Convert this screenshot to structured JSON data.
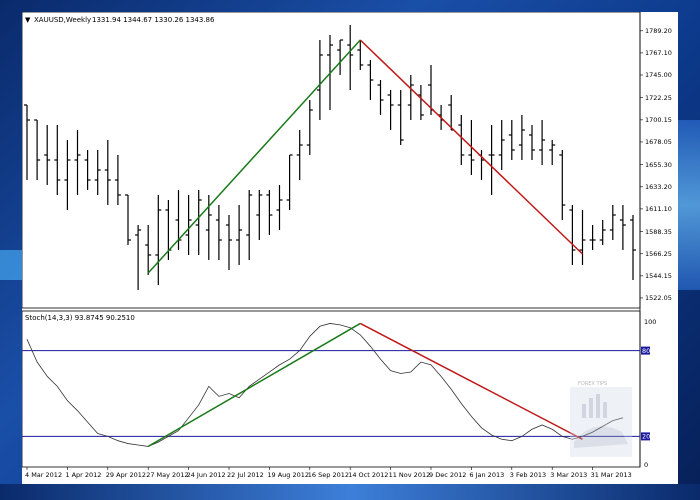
{
  "window": {
    "symbol_header": "XAUUSD,Weekly",
    "ohlc_header": "1331.94 1344.67 1330.26 1343.86",
    "indicator_header": "Stoch(14,3,3) 93.8745 90.2510",
    "watermark": "FOREX TIPS"
  },
  "colors": {
    "bars": "#000000",
    "uptrend_line": "#1a7a1a",
    "downtrend_line": "#c01818",
    "level_lines": "#1a1aa0",
    "stoch_line": "#333333"
  },
  "chart_data": {
    "type": "ohlc",
    "price_axis_ticks": [
      "1789.20",
      "1767.10",
      "1745.00",
      "1722.25",
      "1700.15",
      "1678.05",
      "1655.30",
      "1633.20",
      "1611.10",
      "1588.35",
      "1566.25",
      "1544.15",
      "1522.05"
    ],
    "stoch_axis_ticks": [
      "100",
      "80",
      "20",
      "0"
    ],
    "stoch_levels": [
      80,
      20
    ],
    "x_axis_labels": [
      "4 Mar 2012",
      "1 Apr 2012",
      "29 Apr 2012",
      "27 May 2012",
      "24 Jun 2012",
      "22 Jul 2012",
      "19 Aug 2012",
      "16 Sep 2012",
      "14 Oct 2012",
      "11 Nov 2012",
      "9 Dec 2012",
      "6 Jan 2013",
      "3 Feb 2013",
      "3 Mar 2013",
      "31 Mar 2013"
    ],
    "ohlc": [
      [
        1715,
        1715,
        1640,
        1700
      ],
      [
        1700,
        1700,
        1640,
        1660
      ],
      [
        1665,
        1695,
        1635,
        1660
      ],
      [
        1660,
        1695,
        1625,
        1640
      ],
      [
        1640,
        1680,
        1610,
        1660
      ],
      [
        1660,
        1690,
        1625,
        1665
      ],
      [
        1660,
        1670,
        1630,
        1640
      ],
      [
        1640,
        1670,
        1625,
        1650
      ],
      [
        1650,
        1680,
        1615,
        1640
      ],
      [
        1640,
        1665,
        1615,
        1625
      ],
      [
        1625,
        1625,
        1575,
        1580
      ],
      [
        1585,
        1595,
        1530,
        1590
      ],
      [
        1575,
        1595,
        1545,
        1565
      ],
      [
        1565,
        1625,
        1535,
        1610
      ],
      [
        1610,
        1620,
        1560,
        1570
      ],
      [
        1600,
        1630,
        1570,
        1580
      ],
      [
        1585,
        1625,
        1565,
        1600
      ],
      [
        1595,
        1630,
        1565,
        1620
      ],
      [
        1590,
        1625,
        1560,
        1605
      ],
      [
        1600,
        1615,
        1560,
        1580
      ],
      [
        1595,
        1605,
        1550,
        1580
      ],
      [
        1580,
        1615,
        1555,
        1590
      ],
      [
        1585,
        1630,
        1560,
        1625
      ],
      [
        1605,
        1630,
        1580,
        1625
      ],
      [
        1625,
        1630,
        1585,
        1605
      ],
      [
        1610,
        1635,
        1590,
        1620
      ],
      [
        1620,
        1665,
        1610,
        1665
      ],
      [
        1665,
        1690,
        1640,
        1675
      ],
      [
        1675,
        1720,
        1665,
        1710
      ],
      [
        1730,
        1780,
        1700,
        1765
      ],
      [
        1765,
        1785,
        1710,
        1775
      ],
      [
        1770,
        1780,
        1745,
        1780
      ],
      [
        1775,
        1795,
        1730,
        1765
      ],
      [
        1770,
        1780,
        1750,
        1755
      ],
      [
        1755,
        1760,
        1720,
        1740
      ],
      [
        1735,
        1740,
        1705,
        1720
      ],
      [
        1725,
        1730,
        1690,
        1715
      ],
      [
        1715,
        1730,
        1675,
        1680
      ],
      [
        1715,
        1745,
        1700,
        1735
      ],
      [
        1725,
        1735,
        1700,
        1705
      ],
      [
        1735,
        1755,
        1705,
        1710
      ],
      [
        1705,
        1715,
        1690,
        1700
      ],
      [
        1715,
        1725,
        1690,
        1690
      ],
      [
        1695,
        1705,
        1655,
        1665
      ],
      [
        1665,
        1700,
        1645,
        1660
      ],
      [
        1665,
        1670,
        1640,
        1660
      ],
      [
        1665,
        1695,
        1625,
        1665
      ],
      [
        1665,
        1700,
        1650,
        1680
      ],
      [
        1685,
        1700,
        1660,
        1670
      ],
      [
        1675,
        1705,
        1660,
        1690
      ],
      [
        1685,
        1695,
        1660,
        1670
      ],
      [
        1670,
        1700,
        1655,
        1680
      ],
      [
        1670,
        1680,
        1655,
        1675
      ],
      [
        1665,
        1670,
        1600,
        1615
      ],
      [
        1610,
        1615,
        1555,
        1570
      ],
      [
        1570,
        1610,
        1555,
        1580
      ],
      [
        1580,
        1595,
        1570,
        1580
      ],
      [
        1580,
        1600,
        1575,
        1590
      ],
      [
        1590,
        1615,
        1580,
        1605
      ],
      [
        1600,
        1615,
        1570,
        1595
      ],
      [
        1600,
        1605,
        1540,
        1570
      ]
    ],
    "stoch": [
      88,
      72,
      62,
      55,
      45,
      38,
      30,
      22,
      20,
      17,
      15,
      14,
      13,
      16,
      20,
      24,
      33,
      42,
      55,
      48,
      50,
      47,
      55,
      60,
      65,
      70,
      74,
      80,
      90,
      97,
      99,
      98,
      96,
      91,
      83,
      74,
      66,
      64,
      65,
      72,
      70,
      62,
      53,
      43,
      34,
      26,
      21,
      18,
      17,
      20,
      25,
      28,
      25,
      20,
      18,
      20,
      23,
      27,
      31,
      33
    ],
    "trendlines": [
      {
        "name": "uptrend-price",
        "color_key": "uptrend_line",
        "from": [
          12,
          1547
        ],
        "to": [
          33,
          1780
        ]
      },
      {
        "name": "downtrend-price",
        "color_key": "downtrend_line",
        "from": [
          33,
          1780
        ],
        "to": [
          55,
          1566
        ]
      },
      {
        "name": "uptrend-stoch",
        "color_key": "uptrend_line",
        "from": [
          12,
          13
        ],
        "to": [
          33,
          99
        ]
      },
      {
        "name": "downtrend-stoch",
        "color_key": "downtrend_line",
        "from": [
          33,
          99
        ],
        "to": [
          55,
          18
        ]
      }
    ],
    "price_range": [
      1515,
      1800
    ],
    "stoch_range": [
      0,
      100
    ]
  }
}
